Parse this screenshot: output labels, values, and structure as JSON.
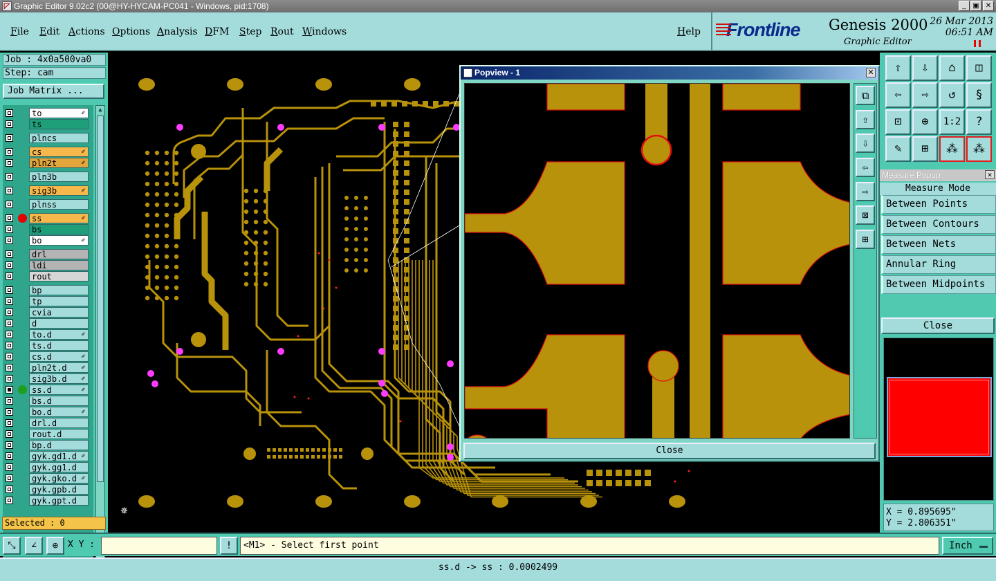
{
  "window": {
    "title": "Graphic Editor 9.02c2 (00@HY-HYCAM-PC041 - Windows, pid:1708)",
    "controls": [
      "_",
      "▣",
      "✕"
    ]
  },
  "menu": {
    "items": [
      "File",
      "Edit",
      "Actions",
      "Options",
      "Analysis",
      "DFM",
      "Step",
      "Rout",
      "Windows"
    ],
    "help": "Help"
  },
  "brand": {
    "logo": "Frontline",
    "product": "Genesis 2000",
    "subtitle": "Graphic Editor",
    "date": "26 Mar 2013",
    "time": "06:51 AM"
  },
  "job": {
    "job_line": "Job : 4x0a500va0",
    "step_line": "Step: cam",
    "matrix_button": "Job Matrix ..."
  },
  "layers": [
    {
      "name": "to",
      "color": "#ffffff",
      "lock": true,
      "dot": ""
    },
    {
      "name": "ts",
      "color": "#1f9e7a",
      "lock": false,
      "dot": ""
    },
    {
      "name": "plncs",
      "color": "#a4dcdc",
      "lock": false,
      "dot": ""
    },
    {
      "name": "cs",
      "color": "#f7b84b",
      "lock": true,
      "dot": ""
    },
    {
      "name": "pln2t",
      "color": "#e2a63c",
      "lock": true,
      "dot": ""
    },
    {
      "name": "pln3b",
      "color": "#a4dcdc",
      "lock": false,
      "dot": ""
    },
    {
      "name": "sig3b",
      "color": "#f7b84b",
      "lock": true,
      "dot": ""
    },
    {
      "name": "plnss",
      "color": "#a4dcdc",
      "lock": false,
      "dot": ""
    },
    {
      "name": "ss",
      "color": "#f7b84b",
      "lock": true,
      "dot": "#e60000"
    },
    {
      "name": "bs",
      "color": "#1f9e7a",
      "lock": false,
      "dot": ""
    },
    {
      "name": "bo",
      "color": "#ffffff",
      "lock": true,
      "dot": ""
    },
    {
      "name": "drl",
      "color": "#b4b4b4",
      "lock": false,
      "dot": ""
    },
    {
      "name": "ldi",
      "color": "#b4b4b4",
      "lock": false,
      "dot": ""
    },
    {
      "name": "rout",
      "color": "#d6d6d6",
      "lock": false,
      "dot": ""
    },
    {
      "name": "bp",
      "color": "#a4dcdc",
      "lock": false,
      "dot": ""
    },
    {
      "name": "tp",
      "color": "#a4dcdc",
      "lock": false,
      "dot": ""
    },
    {
      "name": "cvia",
      "color": "#a4dcdc",
      "lock": false,
      "dot": ""
    },
    {
      "name": "d",
      "color": "#a4dcdc",
      "lock": false,
      "dot": ""
    },
    {
      "name": "to.d",
      "color": "#a4dcdc",
      "lock": true,
      "dot": ""
    },
    {
      "name": "ts.d",
      "color": "#a4dcdc",
      "lock": false,
      "dot": ""
    },
    {
      "name": "cs.d",
      "color": "#a4dcdc",
      "lock": true,
      "dot": ""
    },
    {
      "name": "pln2t.d",
      "color": "#a4dcdc",
      "lock": true,
      "dot": ""
    },
    {
      "name": "sig3b.d",
      "color": "#a4dcdc",
      "lock": true,
      "dot": ""
    },
    {
      "name": "ss.d",
      "color": "#a4dcdc",
      "lock": true,
      "dot": "#1ea01e",
      "active": true
    },
    {
      "name": "bs.d",
      "color": "#a4dcdc",
      "lock": false,
      "dot": ""
    },
    {
      "name": "bo.d",
      "color": "#a4dcdc",
      "lock": true,
      "dot": ""
    },
    {
      "name": "drl.d",
      "color": "#a4dcdc",
      "lock": false,
      "dot": ""
    },
    {
      "name": "rout.d",
      "color": "#a4dcdc",
      "lock": false,
      "dot": ""
    },
    {
      "name": "bp.d",
      "color": "#a4dcdc",
      "lock": false,
      "dot": ""
    },
    {
      "name": "gyk.gd1.d",
      "color": "#a4dcdc",
      "lock": true,
      "dot": ""
    },
    {
      "name": "gyk.gg1.d",
      "color": "#a4dcdc",
      "lock": false,
      "dot": ""
    },
    {
      "name": "gyk.gko.d",
      "color": "#a4dcdc",
      "lock": true,
      "dot": ""
    },
    {
      "name": "gyk.gpb.d",
      "color": "#a4dcdc",
      "lock": false,
      "dot": ""
    },
    {
      "name": "gyk.gpt.d",
      "color": "#a4dcdc",
      "lock": false,
      "dot": ""
    }
  ],
  "selected": "Selected : 0",
  "popview": {
    "title": "Popview - 1",
    "close_button": "Close"
  },
  "measure": {
    "title": "Measure Popup",
    "mode_label": "Measure Mode",
    "options": [
      "Between Points",
      "Between Contours",
      "Between Nets",
      "Annular Ring",
      "Between Midpoints"
    ],
    "close_button": "Close"
  },
  "coords": {
    "x": "X = 0.895695\"",
    "y": "Y = 2.806351\""
  },
  "status": {
    "xy_label": "X Y :",
    "xy_value": "",
    "prompt": "<M1> - Select first point",
    "units": "Inch",
    "bottom": "ss.d -> ss : 0.0002499"
  },
  "colors": {
    "copper": "#b8920a",
    "pad_highlight": "#ff1a1a",
    "via": "#ff3cff",
    "panel": "#a4dcdc",
    "panel_dark": "#4fc9b0"
  }
}
